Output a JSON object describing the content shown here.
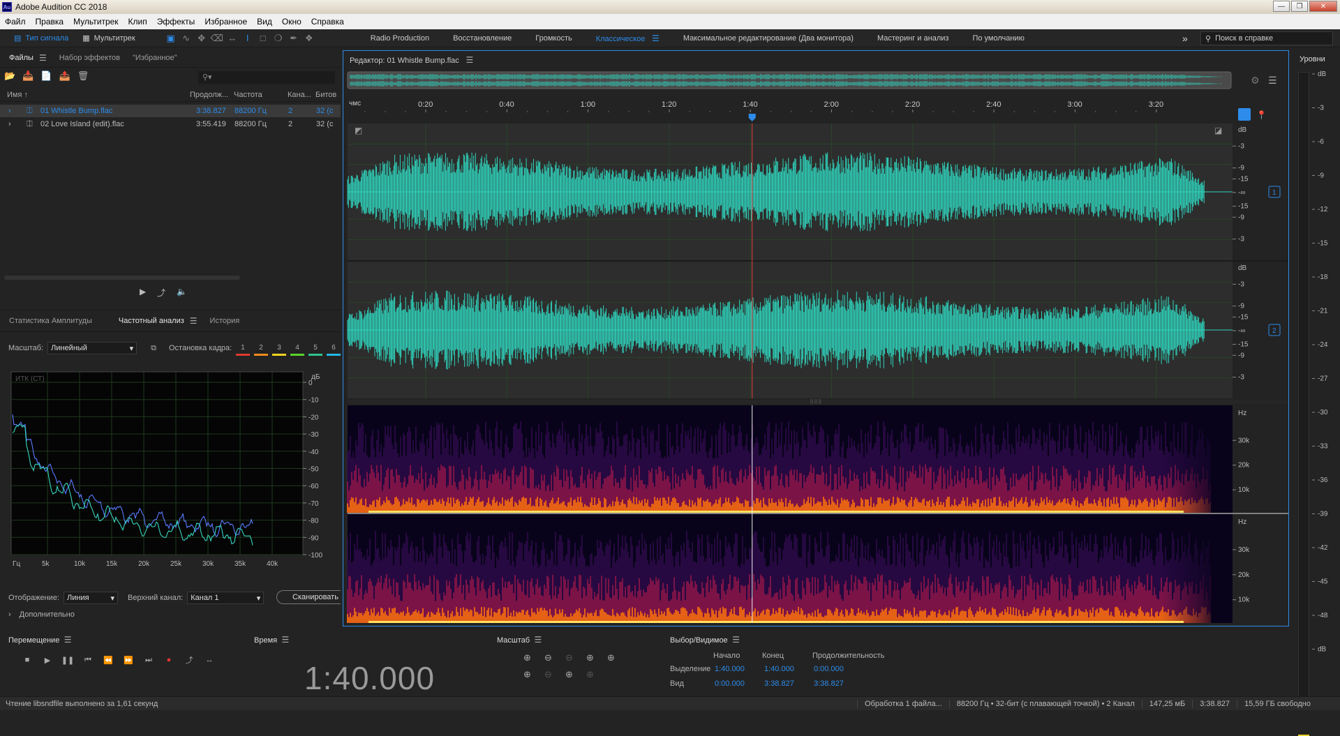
{
  "app": {
    "title": "Adobe Audition CC 2018",
    "logo": "Au"
  },
  "menu": [
    "Файл",
    "Правка",
    "Мультитрек",
    "Клип",
    "Эффекты",
    "Избранное",
    "Вид",
    "Окно",
    "Справка"
  ],
  "toolbar": {
    "mode_waveform": "Тип сигнала",
    "mode_multitrack": "Мультитрек",
    "workspaces": [
      "Radio Production",
      "Восстановление",
      "Громкость",
      "Классическое",
      "Максимальное редактирование (Два монитора)",
      "Мастеринг и анализ",
      "По умолчанию"
    ],
    "active_workspace": "Классическое",
    "overflow": "»",
    "help_placeholder": "Поиск в справке"
  },
  "files_panel": {
    "tabs": [
      "Файлы",
      "Набор эффектов",
      "\"Избранное\""
    ],
    "columns": [
      "Имя",
      "Продолж...",
      "Частота",
      "Кана...",
      "Битов"
    ],
    "search_icon": "search-icon",
    "rows": [
      {
        "name": "01 Whistle Bump.flac",
        "duration": "3:38.827",
        "rate": "88200 Гц",
        "channels": "2",
        "bits": "32 (с"
      },
      {
        "name": "02 Love Island (edit).flac",
        "duration": "3:55.419",
        "rate": "88200 Гц",
        "channels": "2",
        "bits": "32 (с"
      }
    ]
  },
  "analysis_panel": {
    "tabs": [
      "Статистика Амплитуды",
      "Частотный анализ",
      "История"
    ],
    "scale_label": "Масштаб:",
    "scale_value": "Линейный",
    "freeze_label": "Остановка кадра:",
    "frames": [
      "1",
      "2",
      "3",
      "4",
      "5",
      "6"
    ],
    "frame_colors": [
      "#e03a2e",
      "#f08a1c",
      "#f4d21f",
      "#5ad32a",
      "#2fc48f",
      "#22b8e6"
    ],
    "plot_label": "ИТК (СТ)",
    "db_unit": "дБ",
    "db_ticks": [
      "0",
      "-10",
      "-20",
      "-30",
      "-40",
      "-50",
      "-60",
      "-70",
      "-80",
      "-90",
      "-100"
    ],
    "x_ticks": [
      "Гц",
      "5k",
      "10k",
      "15k",
      "20k",
      "25k",
      "30k",
      "35k",
      "40k"
    ],
    "display_label": "Отображение:",
    "display_value": "Линия",
    "top_channel_label": "Верхний канал:",
    "top_channel_value": "Канал 1",
    "scan_button": "Сканировать",
    "more_label": "Дополнительно"
  },
  "editor": {
    "title": "Редактор: 01 Whistle Bump.flac",
    "time_unit": "чмс",
    "time_ticks": [
      "0:20",
      "0:40",
      "1:00",
      "1:20",
      "1:40",
      "2:00",
      "2:20",
      "2:40",
      "3:00",
      "3:20"
    ],
    "db_unit": "dB",
    "db_ticks": [
      "-3",
      "-9",
      "-15",
      "-∞",
      "-15",
      "-9",
      "-3"
    ],
    "channels": [
      "1",
      "2"
    ],
    "hz_unit": "Hz",
    "hz_ticks": [
      "30k",
      "20k",
      "10k"
    ],
    "waveform_color": "#2fd4bd",
    "playhead_color": "#e04040",
    "playhead_time_fraction": 0.4572
  },
  "levels_panel": {
    "title": "Уровни",
    "ticks": [
      "dB",
      "-3",
      "-6",
      "-9",
      "-12",
      "-15",
      "-18",
      "-21",
      "-24",
      "-27",
      "-30",
      "-33",
      "-36",
      "-39",
      "-42",
      "-45",
      "-48",
      "dB"
    ]
  },
  "transport": {
    "title": "Перемещение"
  },
  "time_panel": {
    "title": "Время",
    "value": "1:40.000"
  },
  "zoom_panel": {
    "title": "Масштаб"
  },
  "selection_panel": {
    "title": "Выбор/Видимое",
    "headers": [
      "Начало",
      "Конец",
      "Продолжительность"
    ],
    "rows": [
      {
        "label": "Выделение",
        "start": "1:40.000",
        "end": "1:40.000",
        "duration": "0:00.000"
      },
      {
        "label": "Вид",
        "start": "0:00.000",
        "end": "3:38.827",
        "duration": "3:38.827"
      }
    ]
  },
  "status": {
    "message": "Чтение libsndfile выполнено за 1,61 секунд",
    "processing": "Обработка 1 файла...",
    "format": "88200 Гц • 32-бит (с плавающей точкой) • 2 Канал",
    "size": "147,25 мБ",
    "duration": "3:38.827",
    "free": "15,59 ГБ свободно"
  }
}
